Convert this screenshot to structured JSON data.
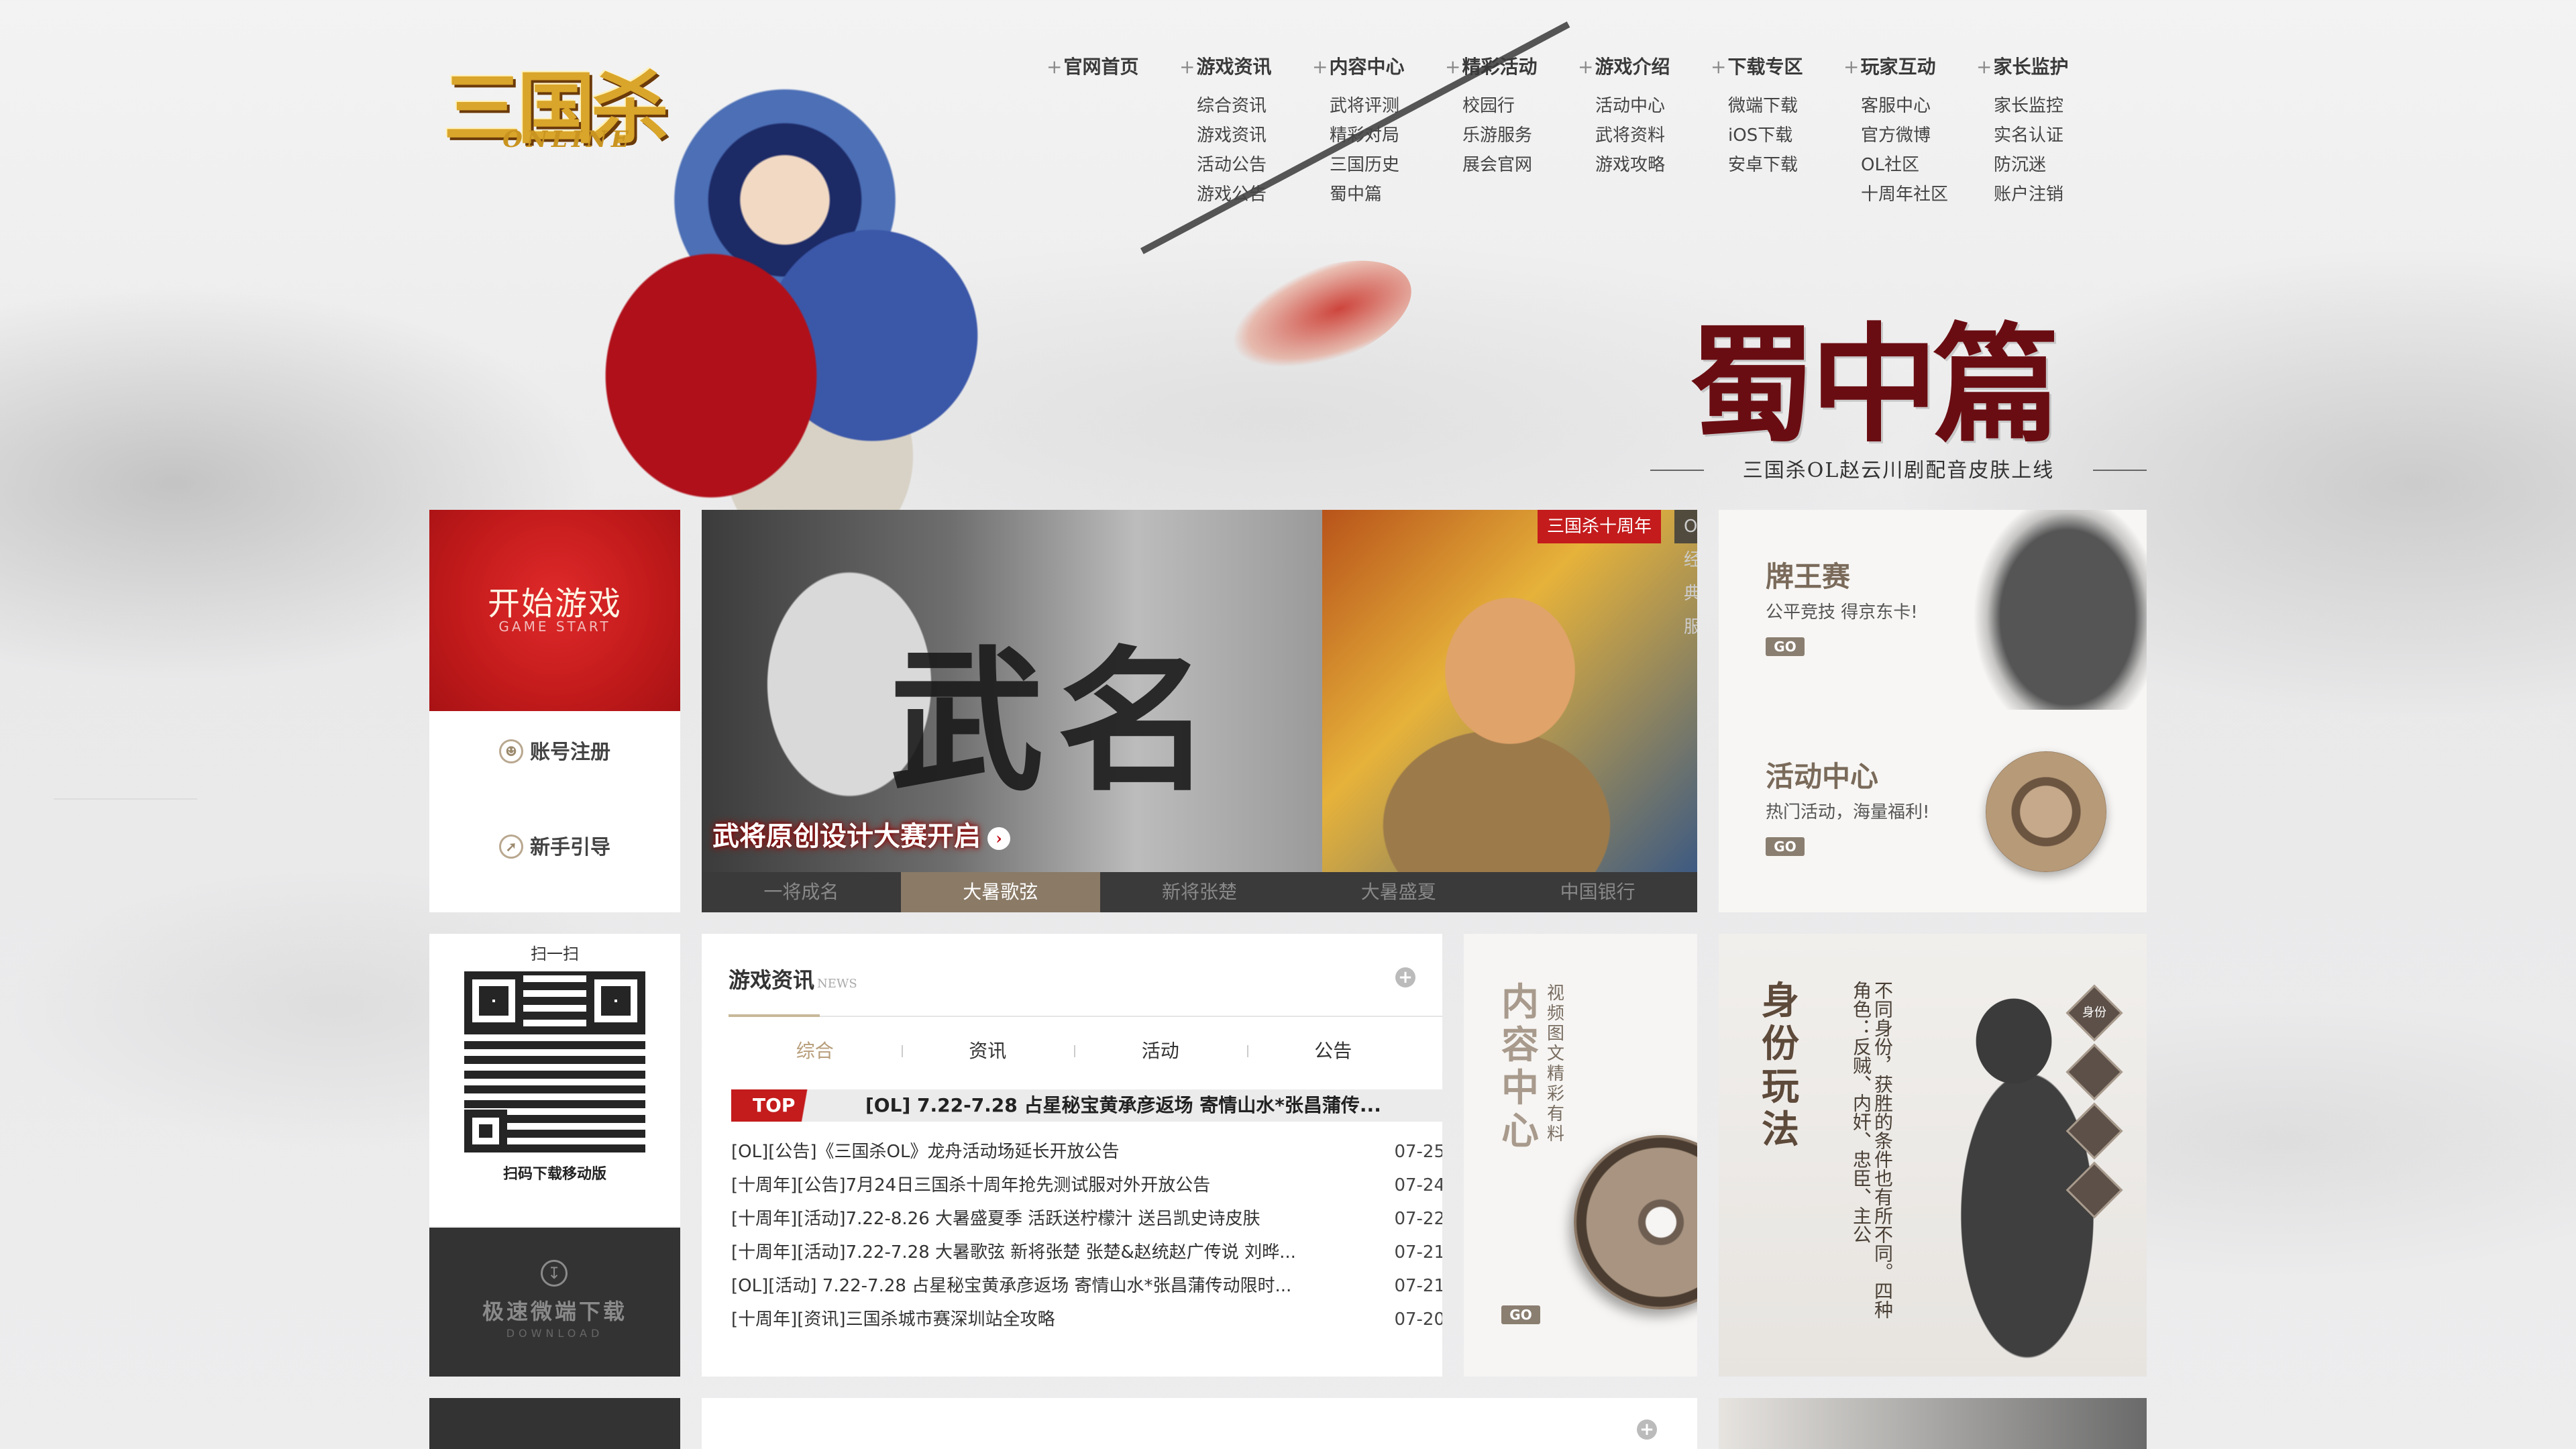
{
  "logo": {
    "text": "三国杀",
    "sub": "ONLINE"
  },
  "nav": [
    {
      "title": "官网首页",
      "items": []
    },
    {
      "title": "游戏资讯",
      "items": [
        "综合资讯",
        "游戏资讯",
        "活动公告",
        "游戏公告"
      ]
    },
    {
      "title": "内容中心",
      "items": [
        "武将评测",
        "精彩对局",
        "三国历史",
        "蜀中篇"
      ]
    },
    {
      "title": "精彩活动",
      "items": [
        "校园行",
        "乐游服务",
        "展会官网"
      ]
    },
    {
      "title": "游戏介绍",
      "items": [
        "活动中心",
        "武将资料",
        "游戏攻略"
      ]
    },
    {
      "title": "下载专区",
      "items": [
        "微端下载",
        "iOS下载",
        "安卓下载"
      ]
    },
    {
      "title": "玩家互动",
      "items": [
        "客服中心",
        "官方微博",
        "OL社区",
        "十周年社区"
      ]
    },
    {
      "title": "家长监护",
      "items": [
        "家长监控",
        "实名认证",
        "防沉迷",
        "账户注销"
      ]
    }
  ],
  "hero": {
    "title": "蜀中篇",
    "subtitle": "三国杀OL赵云川剧配音皮肤上线"
  },
  "start": {
    "title": "开始游戏",
    "subtitle": "GAME START",
    "register": "账号注册",
    "guide": "新手引导"
  },
  "slider": {
    "brush_text": "武名",
    "caption": "武将原创设计大赛开启",
    "tag_red": "三国杀十周年",
    "tag_dark": "OL经典服",
    "tabs": [
      "一将成名",
      "大暑歌弦",
      "新将张楚",
      "大暑盛夏",
      "中国银行"
    ],
    "active_tab": 1
  },
  "right_cards": {
    "card1": {
      "title": "牌王赛",
      "desc": "公平竞技 得京东卡!",
      "go": "GO"
    },
    "card2": {
      "title": "活动中心",
      "desc": "热门活动，海量福利!",
      "go": "GO"
    }
  },
  "qr": {
    "top": "扫一扫",
    "bottom": "扫码下载移动版"
  },
  "download": {
    "title": "极速微端下载",
    "subtitle": "DOWNLOAD"
  },
  "news": {
    "title": "游戏资讯",
    "title_sub": "NEWS",
    "more": "+",
    "tabs": [
      "综合",
      "资讯",
      "活动",
      "公告"
    ],
    "active_tab": 0,
    "top_badge": "TOP",
    "top_title": "[OL] 7.22-7.28 占星秘宝黄承彦返场 寄情山水*张昌蒲传...",
    "items": [
      {
        "text": "[OL][公告]《三国杀OL》龙舟活动场延长开放公告",
        "date": "07-25"
      },
      {
        "text": "[十周年][公告]7月24日三国杀十周年抢先测试服对外开放公告",
        "date": "07-24"
      },
      {
        "text": "[十周年][活动]7.22-8.26 大暑盛夏季 活跃送柠檬汁 送吕凯史诗皮肤",
        "date": "07-22"
      },
      {
        "text": "[十周年][活动]7.22-7.28 大暑歌弦 新将张楚 张楚&赵统赵广传说 刘晔...",
        "date": "07-21"
      },
      {
        "text": "[OL][活动] 7.22-7.28 占星秘宝黄承彦返场 寄情山水*张昌蒲传动限时...",
        "date": "07-21"
      },
      {
        "text": "[十周年][资讯]三国杀城市赛深圳站全攻略",
        "date": "07-20"
      }
    ]
  },
  "content_center": {
    "title": "内容中心",
    "desc": "视频图文精彩有料",
    "go": "GO"
  },
  "identity": {
    "title": "身份玩法",
    "desc": "不同身份，获胜的条件也有所不同。四种角色：反贼、内奸、忠臣、主公",
    "badges": [
      "身份",
      "",
      "",
      ""
    ]
  },
  "bottom": {
    "more": "+"
  }
}
